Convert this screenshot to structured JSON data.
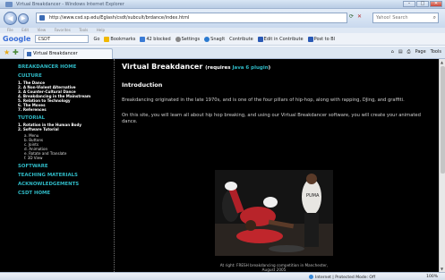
{
  "window": {
    "title": "Virtual Breakdancer - Windows Internet Explorer"
  },
  "address": {
    "url": "http://www.csd.sp.edu/Eglash/csdt/subcult/brdance/index.html",
    "search_placeholder": "Yahoo! Search"
  },
  "menu": [
    "File",
    "Edit",
    "View",
    "Favorites",
    "Tools",
    "Help"
  ],
  "google_toolbar": {
    "logo": "Google",
    "search_value": "CSDT",
    "go": "Go",
    "bookmarks": "Bookmarks",
    "blocked": "42 blocked",
    "settings": "Settings",
    "snagit": "SnagIt",
    "contribute": "Contribute",
    "edit_in_contribute": "Edit in Contribute",
    "post_to_blog": "Post to Bl"
  },
  "tab": {
    "label": "Virtual Breakdancer"
  },
  "command_bar": {
    "page": "Page",
    "tools": "Tools"
  },
  "sidebar": {
    "home": "BREAKDANCER HOME",
    "culture": {
      "title": "CULTURE",
      "items": [
        "1. The Dance",
        "2. A Non-Violent Alternative",
        "3. A Counter-Cultural Dance",
        "4. Breakdancing in the Mainstream",
        "5. Relation to Technology",
        "6. The Moves",
        "7. References"
      ]
    },
    "tutorial": {
      "title": "TUTORIAL",
      "items": [
        "1. Rotation in the Human Body",
        "2. Software Tutorial"
      ],
      "subitems": [
        "a. Menu",
        "b. Buttons",
        "c. Joints",
        "d. Animation",
        "e. Rotate and Translate",
        "f. 3D View"
      ]
    },
    "software": "SOFTWARE",
    "teaching": "TEACHING MATERIALS",
    "acknowledgements": "ACKNOWLEDGEMENTS",
    "csdt_home": "CSDT HOME"
  },
  "main": {
    "title": "Virtual Breakdancer",
    "requires_prefix": "(requires ",
    "requires_link": "Java 6 plugin",
    "requires_suffix": ")",
    "section": "Introduction",
    "para1": "Breakdancing originated in the late 1970s, and is one of the four pillars of hip-hop, along with rapping, DJing, and graffiti.",
    "para2": "On this site, you will learn all about hip hop breaking, and using our Virtual Breakdancer software, you will create your animated dance.",
    "photo_shirt_text": "PUMA",
    "caption": "At right: FRESH breakdancing competition in Manchester, August 2005"
  },
  "status": {
    "zone": "Internet | Protected Mode: Off",
    "zoom": "100%"
  },
  "colors": {
    "accent": "#2fb8c4",
    "page_bg": "#000000"
  }
}
